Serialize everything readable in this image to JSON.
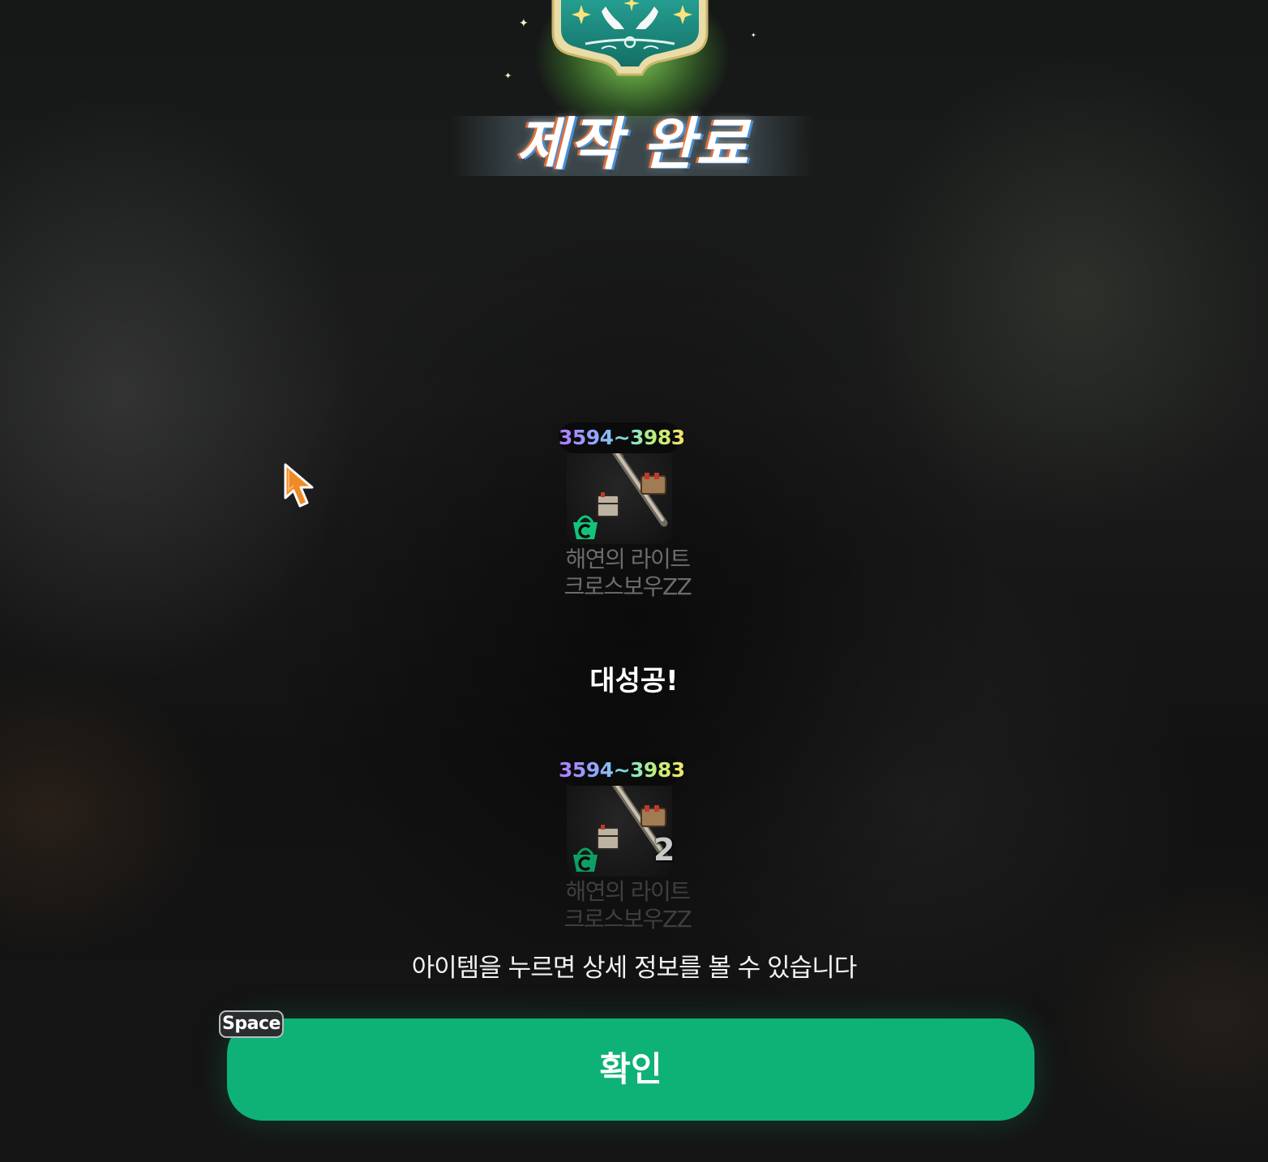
{
  "title": "제작 완료",
  "items": [
    {
      "range": "3594~3983",
      "name_line1": "해연의 라이트",
      "name_line2": "크로스보우ZZ",
      "quantity": null
    },
    {
      "range": "3594~3983",
      "name_line1": "해연의 라이트",
      "name_line2": "크로스보우ZZ",
      "quantity": "2"
    }
  ],
  "result_text": "대성공!",
  "hint_text": "아이템을 누르면 상세 정보를 볼 수 있습니다",
  "confirm_button": {
    "label": "확인",
    "hotkey": "Space"
  },
  "colors": {
    "confirm": "#0fb276",
    "emblem": "#1d8f84",
    "shop_icon": "#12c47a"
  },
  "icons": [
    "crafting-emblem-icon",
    "crossbow-icon",
    "shop-basket-icon",
    "mouse-cursor-icon"
  ]
}
